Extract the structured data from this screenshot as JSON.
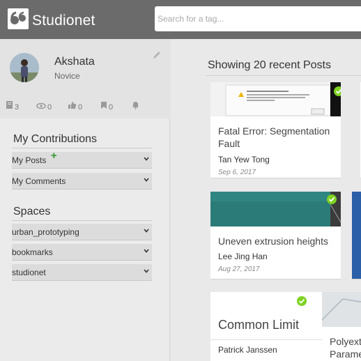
{
  "header": {
    "app_title": "Studionet",
    "search_placeholder": "Search for a tag..."
  },
  "profile": {
    "name": "Akshata",
    "rank": "Novice",
    "stats": {
      "posts": "3",
      "views": "0",
      "likes": "0",
      "bookmarks": "0"
    }
  },
  "contributions": {
    "title": "My Contributions",
    "items": [
      {
        "label": "My Posts",
        "add": "+"
      },
      {
        "label": "My Comments"
      }
    ]
  },
  "spaces": {
    "title": "Spaces",
    "items": [
      {
        "label": "urban_prototyping"
      },
      {
        "label": "bookmarks"
      },
      {
        "label": "studionet"
      }
    ]
  },
  "feed": {
    "heading": "Showing 20 recent Posts",
    "cards": [
      {
        "title_line1": "Fatal Error: Segmentation",
        "title_line2": "Fault",
        "author": "Tan Yew Tong",
        "date": "Sep 6, 2017"
      },
      {
        "title": "Uneven extrusion heights",
        "author": "Lee Jing Han",
        "date": "Aug 27, 2017"
      },
      {
        "title": "Common Limit",
        "author": "Patrick Janssen"
      },
      {
        "title_line1": "Polyext",
        "title_line2": "Parame"
      }
    ]
  },
  "colors": {
    "header": "#6b6b6b",
    "check": "#7ed321",
    "accent_plus": "#2e9b2e"
  }
}
